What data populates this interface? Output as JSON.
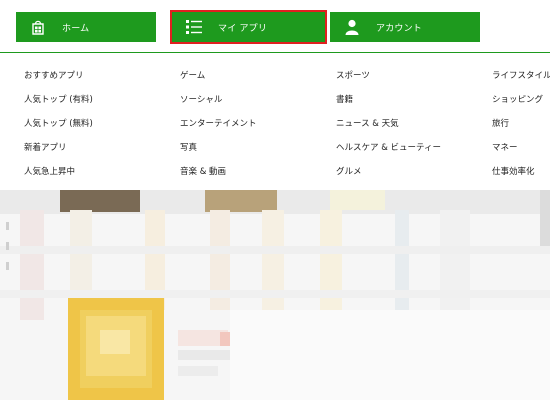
{
  "nav": {
    "home_label": "ホーム",
    "myapps_label": "マイ アプリ",
    "account_label": "アカウント"
  },
  "categories": {
    "col1": [
      "おすすめアプリ",
      "人気トップ (有料)",
      "人気トップ (無料)",
      "新着アプリ",
      "人気急上昇中"
    ],
    "col2": [
      "ゲーム",
      "ソーシャル",
      "エンターテイメント",
      "写真",
      "音楽 & 動画"
    ],
    "col3": [
      "スポーツ",
      "書籍",
      "ニュース & 天気",
      "ヘルスケア & ビューティー",
      "グルメ"
    ],
    "col4": [
      "ライフスタイル",
      "ショッピング",
      "旅行",
      "マネー",
      "仕事効率化"
    ]
  },
  "colors": {
    "accent_green": "#1e9a1e",
    "highlight_red": "#e02020"
  },
  "icons": {
    "home": "store-bag-icon",
    "myapps": "list-icon",
    "account": "person-icon"
  }
}
